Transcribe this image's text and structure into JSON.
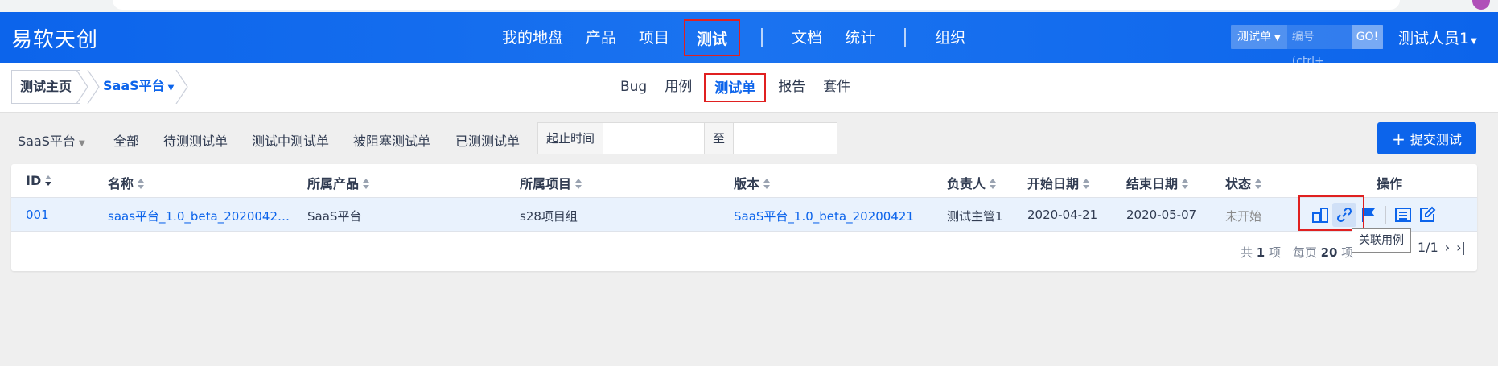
{
  "header": {
    "brand": "易软天创",
    "nav": [
      {
        "label": "我的地盘"
      },
      {
        "label": "产品"
      },
      {
        "label": "项目"
      },
      {
        "label": "测试",
        "active": true
      },
      {
        "label": "文档"
      },
      {
        "label": "统计"
      },
      {
        "label": "组织"
      }
    ],
    "search": {
      "type": "测试单",
      "placeholder": "编号(ctrl+",
      "go": "GO!"
    },
    "user": "测试人员1"
  },
  "subheader": {
    "crumb_home": "测试主页",
    "crumb_product": "SaaS平台",
    "tabs": [
      {
        "label": "Bug"
      },
      {
        "label": "用例"
      },
      {
        "label": "测试单",
        "active": true
      },
      {
        "label": "报告"
      },
      {
        "label": "套件"
      }
    ]
  },
  "filters": {
    "product": "SaaS平台",
    "items": [
      "全部",
      "待测测试单",
      "测试中测试单",
      "被阻塞测试单",
      "已测测试单"
    ],
    "date_label": "起止时间",
    "date_sep": "至",
    "submit": "提交测试"
  },
  "table": {
    "columns": [
      "ID",
      "名称",
      "所属产品",
      "所属项目",
      "版本",
      "负责人",
      "开始日期",
      "结束日期",
      "状态",
      "操作"
    ],
    "rows": [
      {
        "id": "001",
        "name": "saas平台_1.0_beta_2020042…",
        "product": "SaaS平台",
        "project": "s28项目组",
        "build": "SaaS平台_1.0_beta_20200421",
        "owner": "测试主管1",
        "begin": "2020-04-21",
        "end": "2020-05-07",
        "status": "未开始"
      }
    ],
    "actions": [
      "cases-icon",
      "link-icon",
      "flag-icon",
      "view-icon",
      "edit-icon"
    ]
  },
  "pager": {
    "total_prefix": "共",
    "total": "1",
    "total_suffix": "项",
    "per_prefix": "每页",
    "per": "20",
    "per_suffix": "项",
    "page": "1/1"
  },
  "tooltip": "关联用例",
  "colors": {
    "brand": "#0c64eb",
    "highlight": "#e02020",
    "row_bg": "#e9f2fd"
  }
}
